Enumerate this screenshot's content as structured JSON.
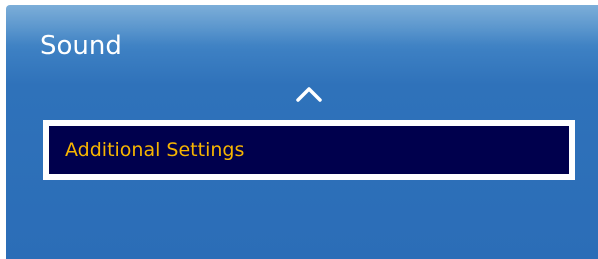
{
  "menu": {
    "title": "Sound",
    "scroll_up_icon": "chevron-up-icon",
    "selected_item": {
      "label": "Additional Settings"
    }
  },
  "colors": {
    "panel_background": "#2f72ba",
    "selected_background": "#00004d",
    "selected_border": "#ffffff",
    "selected_text": "#f7b500",
    "title_text": "#ffffff"
  }
}
